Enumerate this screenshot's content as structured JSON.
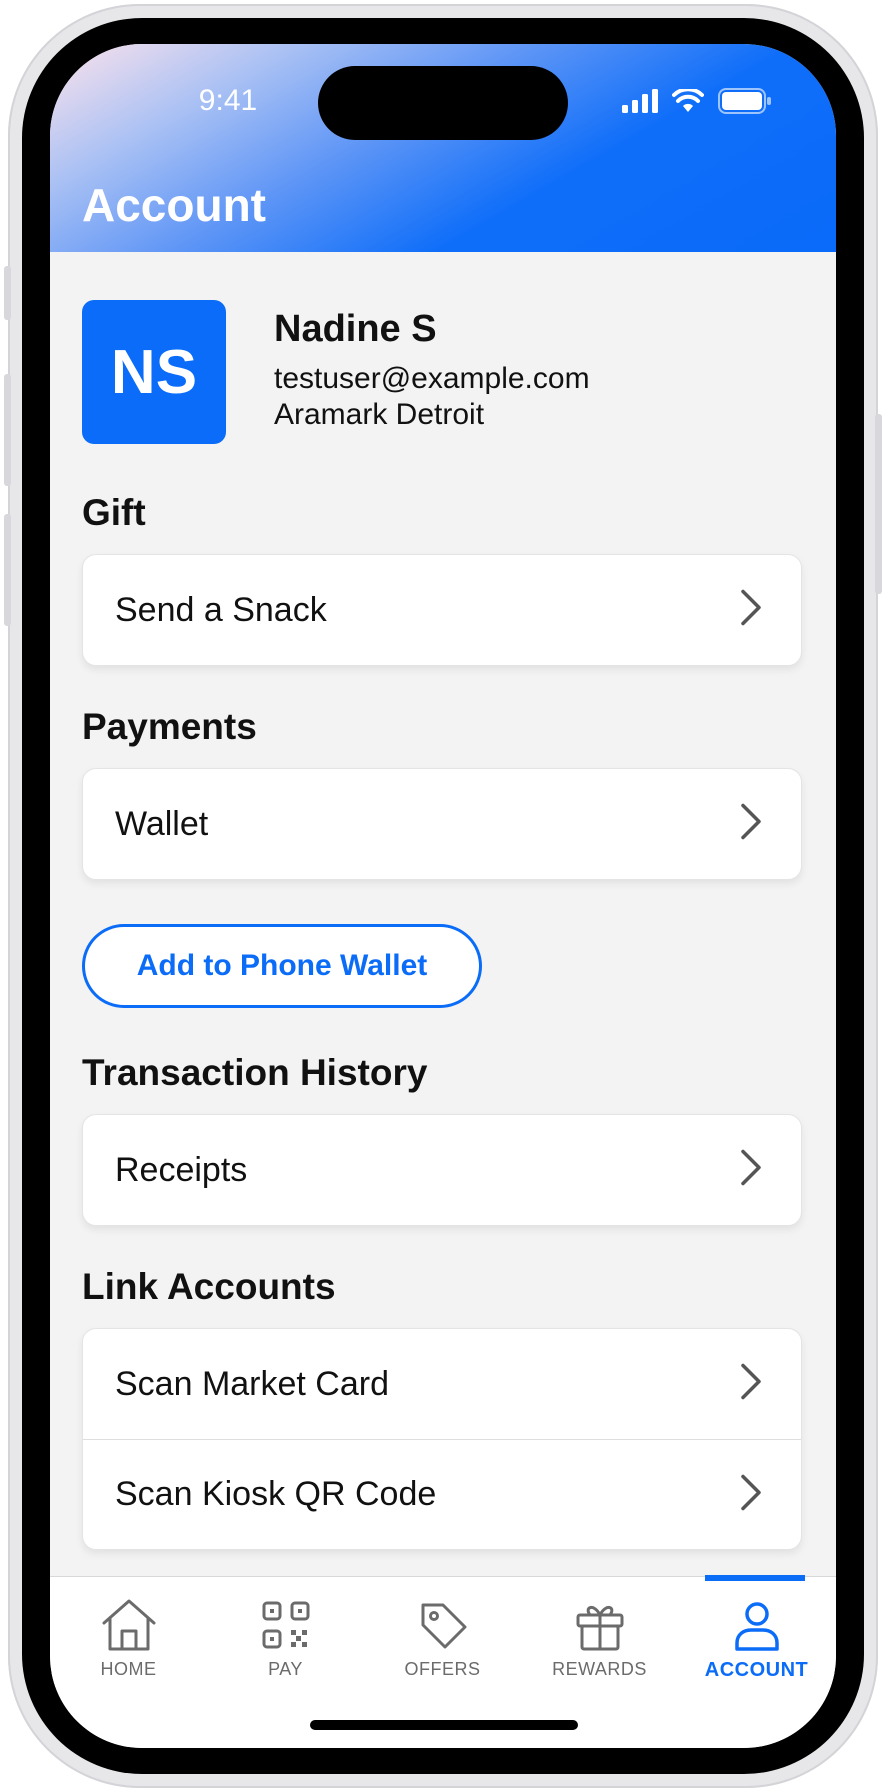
{
  "status_bar": {
    "time": "9:41"
  },
  "header": {
    "title": "Account"
  },
  "profile": {
    "initials": "NS",
    "name": "Nadine S",
    "email": "testuser@example.com",
    "location": "Aramark Detroit"
  },
  "sections": {
    "gift": {
      "title": "Gift",
      "items": [
        "Send a Snack"
      ]
    },
    "payments": {
      "title": "Payments",
      "items": [
        "Wallet"
      ],
      "button": "Add to Phone Wallet"
    },
    "history": {
      "title": "Transaction History",
      "items": [
        "Receipts"
      ]
    },
    "link": {
      "title": "Link Accounts",
      "items": [
        "Scan Market Card",
        "Scan Kiosk QR Code"
      ]
    }
  },
  "tabs": [
    {
      "label": "HOME",
      "icon": "home-icon"
    },
    {
      "label": "PAY",
      "icon": "qr-code-icon"
    },
    {
      "label": "OFFERS",
      "icon": "tag-icon"
    },
    {
      "label": "REWARDS",
      "icon": "gift-icon"
    },
    {
      "label": "ACCOUNT",
      "icon": "user-icon",
      "active": true
    }
  ],
  "colors": {
    "accent": "#0B6CF7",
    "background": "#F3F3F3",
    "text": "#111111"
  }
}
